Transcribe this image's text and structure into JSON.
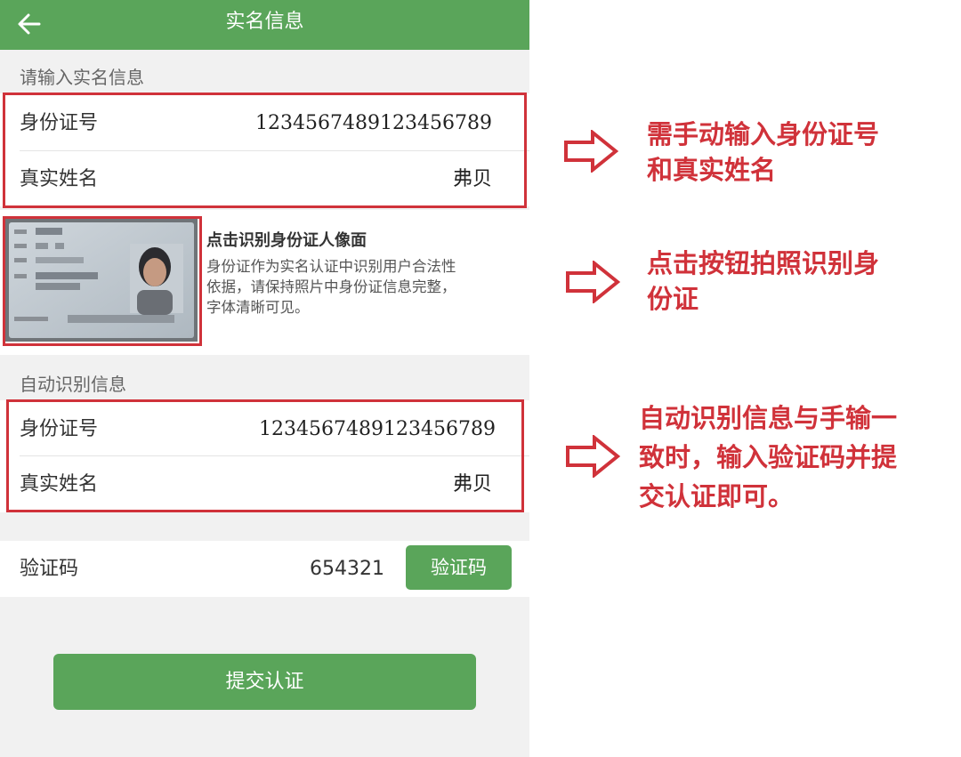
{
  "header": {
    "title": "实名信息"
  },
  "manual_section": {
    "label": "请输入实名信息",
    "id_label": "身份证号",
    "id_value": "1234567489123456789",
    "name_label": "真实姓名",
    "name_value": "弗贝"
  },
  "id_card": {
    "title": "点击识别身份证人像面",
    "desc_lines": [
      "身份证作为实名认证中识别用户合法性",
      "依据，请保持照片中身份证信息完整，",
      "字体清晰可见。"
    ]
  },
  "auto_section": {
    "label": "自动识别信息",
    "id_label": "身份证号",
    "id_value": "1234567489123456789",
    "name_label": "真实姓名",
    "name_value": "弗贝"
  },
  "verify": {
    "label": "验证码",
    "value": "654321",
    "button": "验证码"
  },
  "submit": {
    "label": "提交认证"
  },
  "annotations": [
    {
      "lines": [
        "需手动输入身份证号",
        "和真实姓名"
      ]
    },
    {
      "lines": [
        "点击按钮拍照识别身",
        "份证"
      ]
    },
    {
      "lines": [
        "自动识别信息与手输一",
        "致时，输入验证码并提",
        "交认证即可。"
      ]
    }
  ],
  "colors": {
    "brand_green": "#5aa55a",
    "annotation_red": "#d0323a"
  },
  "icons": [
    "back-arrow-icon",
    "right-arrow-icon"
  ]
}
